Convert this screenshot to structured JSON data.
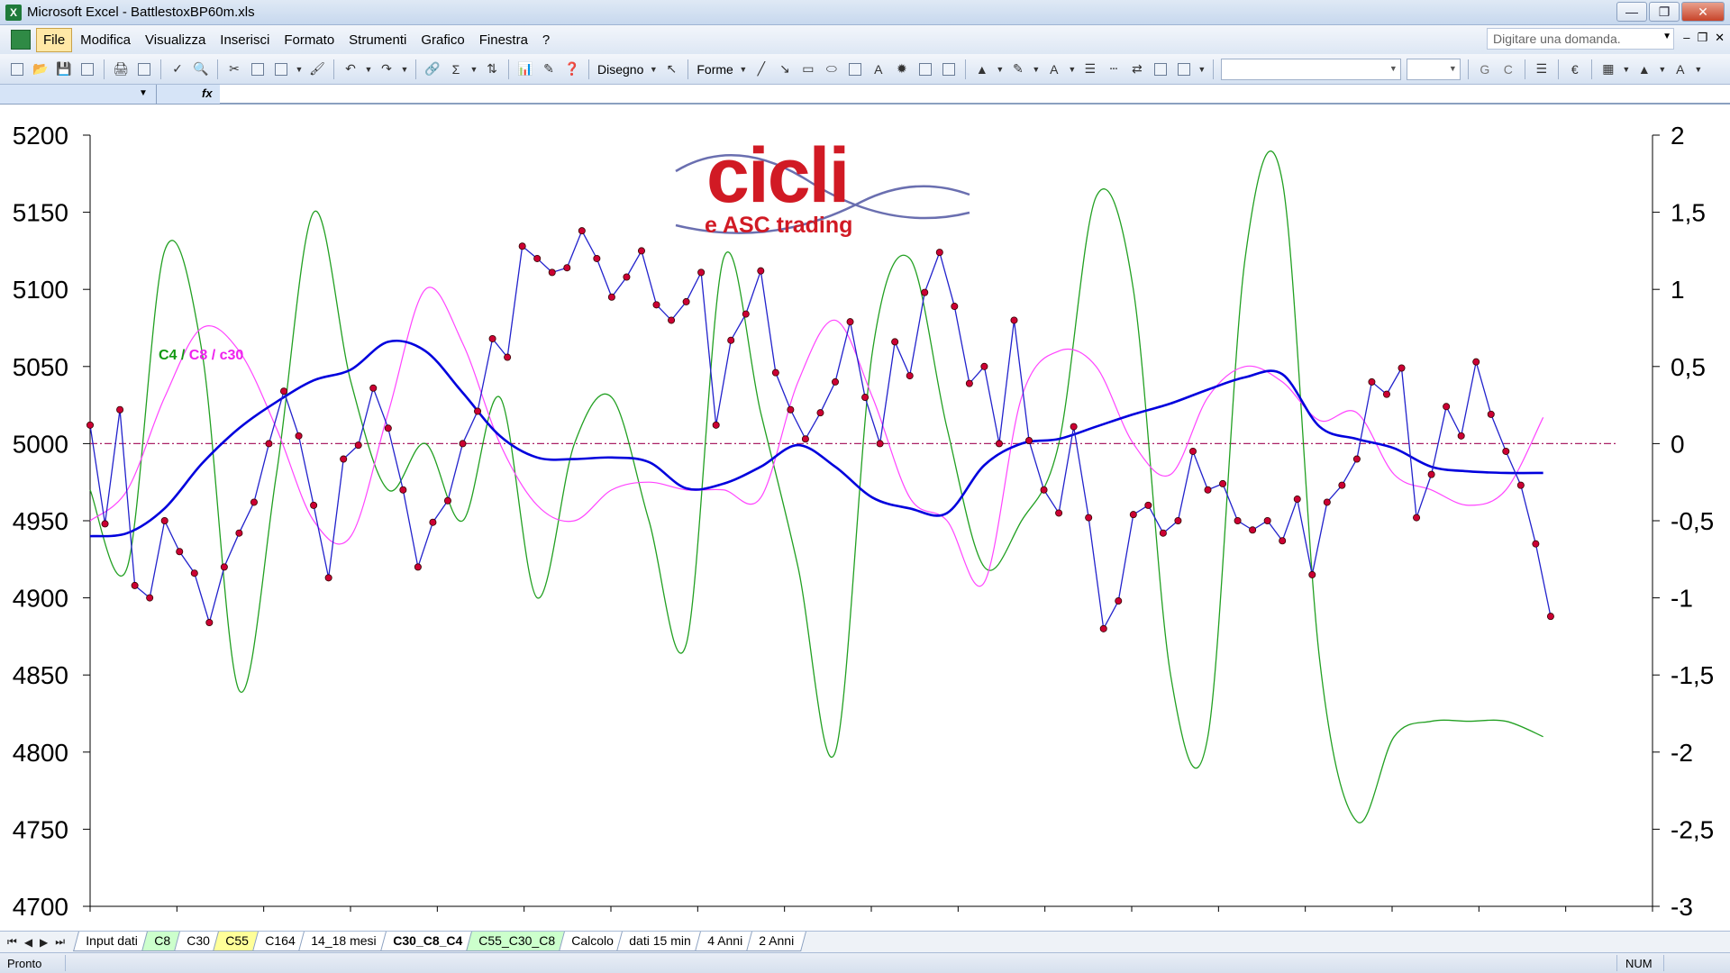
{
  "window": {
    "title": "Microsoft Excel - BattlestoxBP60m.xls"
  },
  "menu": {
    "items": [
      "File",
      "Modifica",
      "Visualizza",
      "Inserisci",
      "Formato",
      "Strumenti",
      "Grafico",
      "Finestra",
      "?"
    ]
  },
  "help": {
    "placeholder": "Digitare una domanda."
  },
  "toolbar": {
    "disegno_label": "Disegno",
    "forme_label": "Forme",
    "bold_label": "G",
    "italic_label": "C"
  },
  "chart_overlay": {
    "logo_word": "cicli",
    "logo_sub": "e ASC trading",
    "series_note": {
      "c4": "C4 / ",
      "c8": "C8 / c30"
    }
  },
  "sheets": {
    "tabs": [
      {
        "label": "Input dati",
        "style": "plain"
      },
      {
        "label": "C8",
        "style": "green"
      },
      {
        "label": "C30",
        "style": "plain"
      },
      {
        "label": "C55",
        "style": "yellow"
      },
      {
        "label": "C164",
        "style": "plain"
      },
      {
        "label": "14_18 mesi",
        "style": "plain"
      },
      {
        "label": "C30_C8_C4",
        "style": "active"
      },
      {
        "label": "C55_C30_C8",
        "style": "green"
      },
      {
        "label": "Calcolo",
        "style": "plain"
      },
      {
        "label": "dati 15 min",
        "style": "plain"
      },
      {
        "label": "4 Anni",
        "style": "plain"
      },
      {
        "label": "2 Anni",
        "style": "plain"
      }
    ]
  },
  "status": {
    "text": "Pronto",
    "num": "NUM"
  },
  "colors": {
    "price": "#2222cc",
    "price_marker": "#cc0033",
    "c30": "#0000dd",
    "c8": "#ff44ff",
    "c4": "#22a022",
    "zero_line": "#aa2266"
  },
  "chart_data": {
    "type": "line",
    "left_axis": {
      "ylim": [
        4700,
        5200
      ],
      "ticks": [
        4700,
        4750,
        4800,
        4850,
        4900,
        4950,
        5000,
        5050,
        5100,
        5150,
        5200
      ]
    },
    "right_axis": {
      "ylim": [
        -3,
        2
      ],
      "ticks": [
        "-3",
        "-2,5",
        "-2",
        "-1,5",
        "-1",
        "-0,5",
        "0",
        "0,5",
        "1",
        "1,5",
        "2"
      ]
    },
    "x_range": [
      0,
      1000
    ],
    "grid": false,
    "series": [
      {
        "axis": "left",
        "markers": true,
        "x": [
          0,
          10,
          20,
          30,
          40,
          50,
          60,
          70,
          80,
          90,
          100,
          110,
          120,
          130,
          140,
          150,
          160,
          170,
          180,
          190,
          200,
          210,
          220,
          230,
          240,
          250,
          260,
          270,
          280,
          290,
          300,
          310,
          320,
          330,
          340,
          350,
          360,
          370,
          380,
          390,
          400,
          410,
          420,
          430,
          440,
          450,
          460,
          470,
          480,
          490,
          500,
          510,
          520,
          530,
          540,
          550,
          560,
          570,
          580,
          590,
          600,
          610,
          620,
          630,
          640,
          650,
          660,
          670,
          680,
          690,
          700,
          710,
          720,
          730,
          740,
          750,
          760,
          770,
          780,
          790,
          800,
          810,
          820,
          830,
          840,
          850,
          860,
          870,
          880,
          890,
          900,
          910,
          920,
          930,
          940,
          950,
          960,
          970,
          980
        ],
        "values": [
          5012,
          4948,
          5022,
          4908,
          4900,
          4950,
          4930,
          4916,
          4884,
          4920,
          4942,
          4962,
          5000,
          5034,
          5005,
          4960,
          4913,
          4990,
          4999,
          5036,
          5010,
          4970,
          4920,
          4949,
          4963,
          5000,
          5021,
          5068,
          5056,
          5128,
          5120,
          5111,
          5114,
          5138,
          5120,
          5095,
          5108,
          5125,
          5090,
          5080,
          5092,
          5111,
          5012,
          5067,
          5084,
          5112,
          5046,
          5022,
          5003,
          5020,
          5040,
          5079,
          5030,
          5000,
          5066,
          5044,
          5098,
          5124,
          5089,
          5039,
          5050,
          5000,
          5080,
          5002,
          4970,
          4955,
          5011,
          4952,
          4880,
          4898,
          4954,
          4960,
          4942,
          4950,
          4995,
          4970,
          4974,
          4950,
          4944,
          4950,
          4937,
          4964,
          4915,
          4962,
          4973,
          4990,
          5040,
          5032,
          5049,
          4952,
          4980,
          5024,
          5005,
          5053,
          5019,
          4995,
          4973,
          4935,
          4888
        ]
      },
      {
        "axis": "left",
        "markers": false,
        "x": [
          0,
          25,
          50,
          75,
          100,
          125,
          150,
          175,
          200,
          225,
          250,
          275,
          300,
          325,
          350,
          375,
          400,
          425,
          450,
          475,
          500,
          525,
          550,
          575,
          600,
          625,
          650,
          675,
          700,
          725,
          750,
          775,
          800,
          825,
          850,
          875,
          900,
          925,
          950,
          975
        ],
        "values": [
          4940,
          4942,
          4958,
          4987,
          5010,
          5027,
          5041,
          5048,
          5066,
          5060,
          5033,
          5005,
          4991,
          4990,
          4991,
          4988,
          4971,
          4974,
          4985,
          4999,
          4985,
          4965,
          4958,
          4955,
          4986,
          5000,
          5003,
          5011,
          5019,
          5026,
          5035,
          5043,
          5045,
          5011,
          5003,
          4997,
          4985,
          4982,
          4981,
          4981
        ]
      },
      {
        "axis": "right",
        "markers": false,
        "x": [
          0,
          25,
          50,
          75,
          100,
          125,
          150,
          175,
          200,
          225,
          250,
          275,
          300,
          325,
          350,
          375,
          400,
          425,
          450,
          475,
          500,
          525,
          550,
          575,
          600,
          625,
          650,
          675,
          700,
          725,
          750,
          775,
          800,
          825,
          850,
          875,
          900,
          925,
          950,
          975
        ],
        "values": [
          -0.5,
          -0.3,
          0.3,
          0.75,
          0.6,
          0.1,
          -0.5,
          -0.6,
          0.2,
          1.0,
          0.65,
          0.0,
          -0.4,
          -0.5,
          -0.3,
          -0.25,
          -0.3,
          -0.3,
          -0.35,
          0.4,
          0.8,
          0.3,
          -0.35,
          -0.5,
          -0.9,
          0.3,
          0.6,
          0.5,
          0.0,
          -0.2,
          0.3,
          0.5,
          0.4,
          0.15,
          0.2,
          -0.2,
          -0.3,
          -0.4,
          -0.3,
          0.17
        ]
      },
      {
        "axis": "right",
        "markers": false,
        "x": [
          0,
          25,
          50,
          75,
          100,
          125,
          150,
          175,
          200,
          225,
          250,
          275,
          300,
          325,
          350,
          375,
          400,
          425,
          450,
          475,
          500,
          525,
          550,
          575,
          600,
          625,
          650,
          675,
          700,
          725,
          750,
          775,
          800,
          825,
          850,
          875,
          900,
          925,
          950,
          975
        ],
        "values": [
          -0.3,
          -0.8,
          1.25,
          0.6,
          -1.6,
          -0.2,
          1.5,
          0.4,
          -0.3,
          0.0,
          -0.5,
          0.3,
          -1.0,
          0.0,
          0.3,
          -0.5,
          -1.3,
          1.2,
          0.2,
          -0.8,
          -2.0,
          0.6,
          1.2,
          0.1,
          -0.8,
          -0.5,
          0.0,
          1.6,
          1.0,
          -1.5,
          -1.9,
          1.2,
          1.7,
          -1.4,
          -2.45,
          -1.9,
          -1.8,
          -1.8,
          -1.8,
          -1.9
        ]
      }
    ],
    "zero_line": {
      "axis": "right",
      "value": 0
    }
  }
}
